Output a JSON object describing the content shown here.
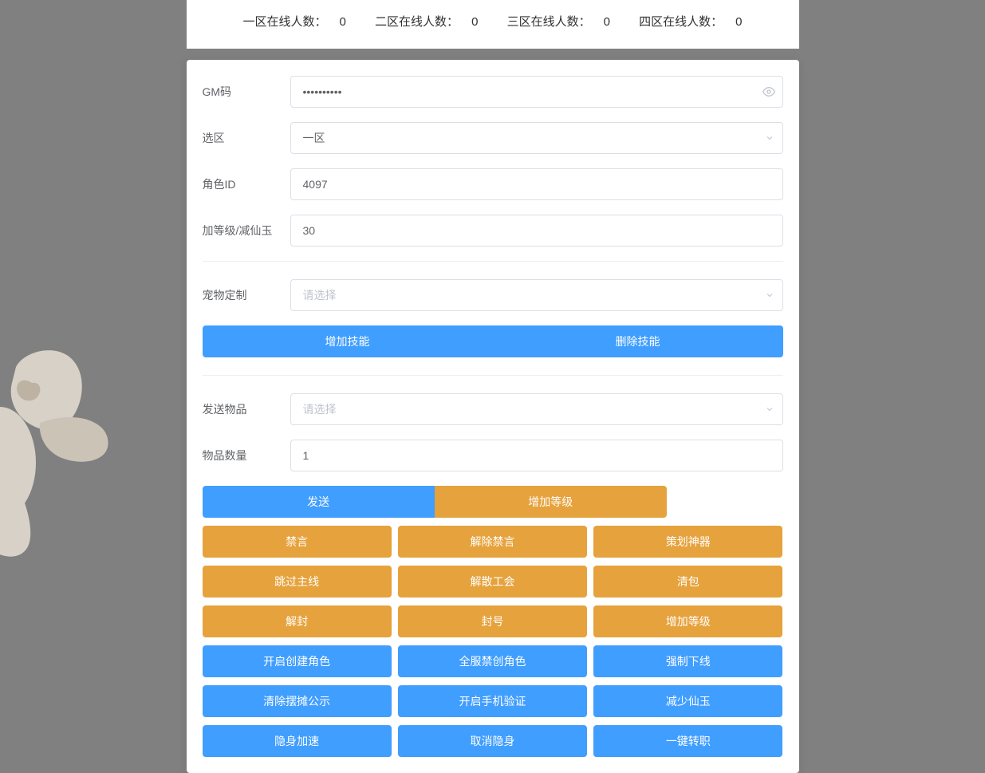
{
  "stats": {
    "zone1": {
      "label": "一区在线人数：",
      "value": "0"
    },
    "zone2": {
      "label": "二区在线人数：",
      "value": "0"
    },
    "zone3": {
      "label": "三区在线人数：",
      "value": "0"
    },
    "zone4": {
      "label": "四区在线人数：",
      "value": "0"
    }
  },
  "form": {
    "gm_code": {
      "label": "GM码",
      "value": "••••••••••"
    },
    "zone": {
      "label": "选区",
      "value": "一区"
    },
    "role_id": {
      "label": "角色ID",
      "value": "4097"
    },
    "level_or_jade": {
      "label": "加等级/减仙玉",
      "value": "30"
    },
    "pet_custom": {
      "label": "宠物定制",
      "placeholder": "请选择"
    },
    "send_item": {
      "label": "发送物品",
      "placeholder": "请选择"
    },
    "item_count": {
      "label": "物品数量",
      "value": "1"
    }
  },
  "buttons": {
    "skill": {
      "add": "增加技能",
      "del": "删除技能"
    },
    "send_row": {
      "send": "发送",
      "add_level": "增加等级"
    },
    "grid_orange": [
      [
        "禁言",
        "解除禁言",
        "策划神器"
      ],
      [
        "跳过主线",
        "解散工会",
        "清包"
      ],
      [
        "解封",
        "封号",
        "增加等级"
      ]
    ],
    "grid_blue": [
      [
        "开启创建角色",
        "全服禁创角色",
        "强制下线"
      ],
      [
        "清除摆摊公示",
        "开启手机验证",
        "减少仙玉"
      ],
      [
        "隐身加速",
        "取消隐身",
        "一键转职"
      ]
    ]
  }
}
